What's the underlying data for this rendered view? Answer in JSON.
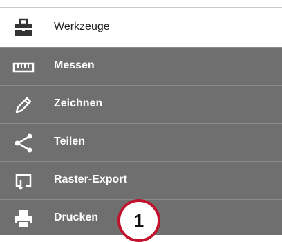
{
  "menu": {
    "header": {
      "label": "Werkzeuge",
      "icon": "toolbox-icon"
    },
    "items": [
      {
        "label": "Messen",
        "icon": "ruler-icon"
      },
      {
        "label": "Zeichnen",
        "icon": "pencil-icon"
      },
      {
        "label": "Teilen",
        "icon": "share-icon"
      },
      {
        "label": "Raster-Export",
        "icon": "raster-export-icon"
      },
      {
        "label": "Drucken",
        "icon": "printer-icon"
      }
    ]
  },
  "callout": {
    "number": "1",
    "color": "#c0122c"
  },
  "colors": {
    "item_background": "#6f6f6f",
    "item_text": "#ffffff",
    "header_text": "#222222"
  }
}
